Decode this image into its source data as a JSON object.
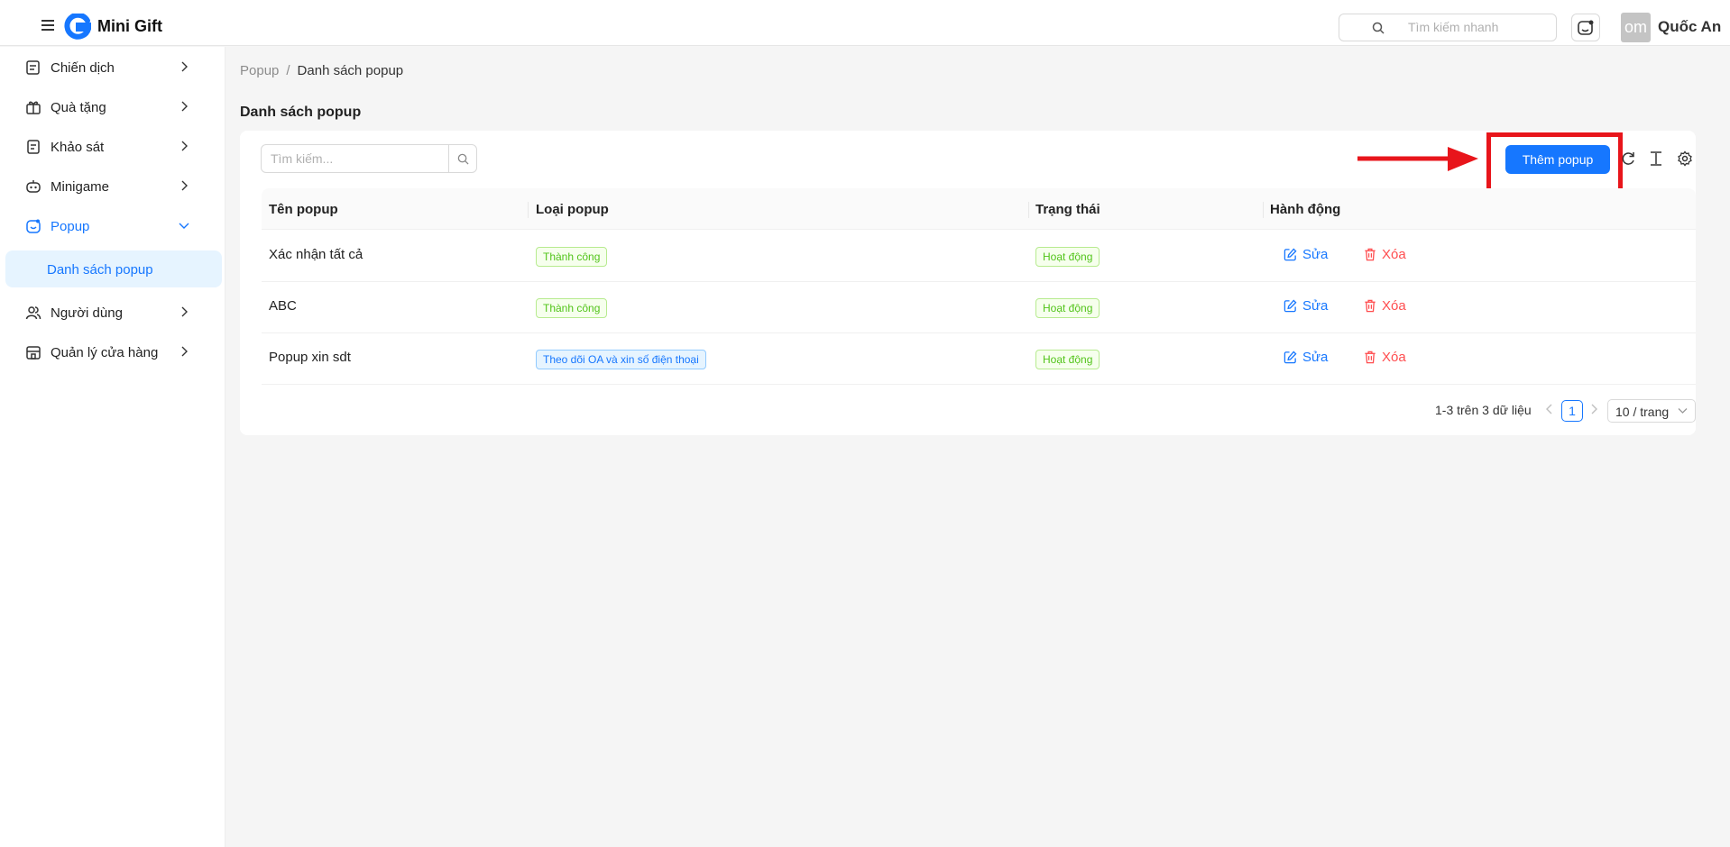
{
  "header": {
    "app_title": "Mini Gift",
    "search_placeholder": "Tìm kiếm nhanh",
    "avatar_text": "om",
    "user_name": "Quốc An"
  },
  "sidebar": {
    "items": [
      {
        "label": "Chiến dịch",
        "icon": "campaign-icon"
      },
      {
        "label": "Quà tặng",
        "icon": "gift-icon"
      },
      {
        "label": "Khảo sát",
        "icon": "survey-icon"
      },
      {
        "label": "Minigame",
        "icon": "game-icon"
      },
      {
        "label": "Popup",
        "icon": "popup-icon",
        "active": true,
        "expanded": true
      },
      {
        "label": "Người dùng",
        "icon": "users-icon"
      },
      {
        "label": "Quản lý cửa hàng",
        "icon": "store-icon"
      }
    ],
    "sub_items": [
      {
        "label": "Danh sách popup",
        "active": true
      }
    ]
  },
  "breadcrumb": {
    "root": "Popup",
    "separator": "/",
    "current": "Danh sách popup"
  },
  "page": {
    "title": "Danh sách popup"
  },
  "toolbar": {
    "search_placeholder": "Tìm kiếm...",
    "add_button": "Thêm popup"
  },
  "table": {
    "columns": [
      "Tên popup",
      "Loại popup",
      "Trạng thái",
      "Hành động"
    ],
    "rows": [
      {
        "name": "Xác nhận tất cả",
        "type": "Thành công",
        "type_color": "green",
        "status": "Hoạt động",
        "edit": "Sửa",
        "delete": "Xóa"
      },
      {
        "name": "ABC",
        "type": "Thành công",
        "type_color": "green",
        "status": "Hoạt động",
        "edit": "Sửa",
        "delete": "Xóa"
      },
      {
        "name": "Popup xin sdt",
        "type": "Theo dõi OA và xin số điện thoại",
        "type_color": "blue",
        "status": "Hoạt động",
        "edit": "Sửa",
        "delete": "Xóa"
      }
    ]
  },
  "pagination": {
    "total_text": "1-3 trên 3 dữ liệu",
    "current_page": "1",
    "page_size": "10 / trang"
  },
  "colors": {
    "primary": "#1677ff",
    "danger": "#ff4d4f",
    "success": "#52c41a",
    "annotation": "#e8151b"
  }
}
